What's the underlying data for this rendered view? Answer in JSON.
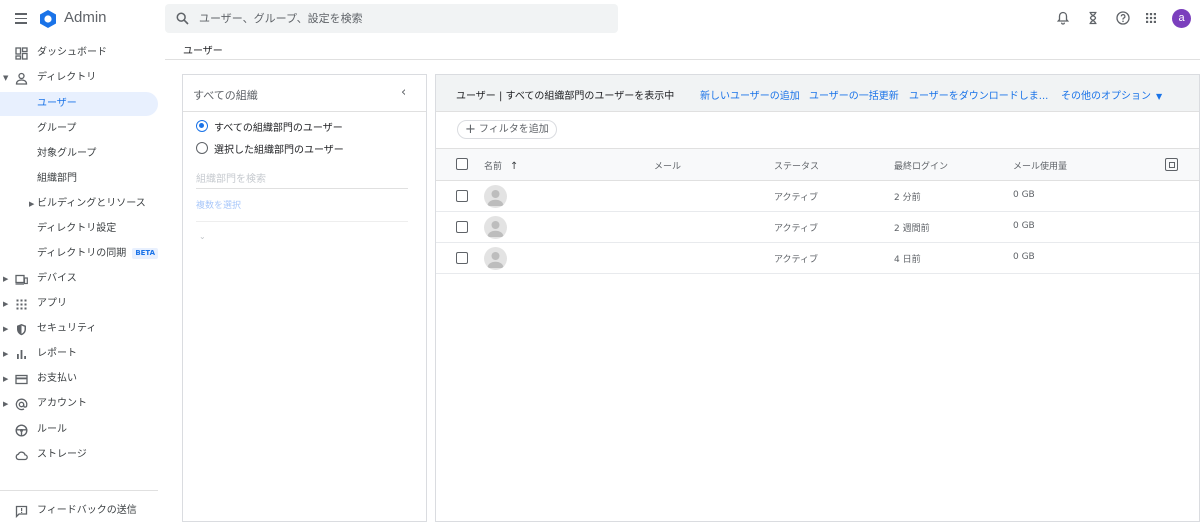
{
  "app": {
    "name": "Admin"
  },
  "search": {
    "placeholder": "ユーザー、グループ、設定を検索"
  },
  "user_avatar_letter": "a",
  "sidebar": {
    "items": [
      {
        "label": "ダッシュボード",
        "icon": "dashboard-icon"
      },
      {
        "label": "ディレクトリ",
        "icon": "person-icon",
        "expanded": true
      },
      {
        "label": "ユーザー",
        "active": true
      },
      {
        "label": "グループ"
      },
      {
        "label": "対象グループ"
      },
      {
        "label": "組織部門"
      },
      {
        "label": "ビルディングとリソース"
      },
      {
        "label": "ディレクトリ設定"
      },
      {
        "label": "ディレクトリの同期",
        "badge": "BETA"
      },
      {
        "label": "デバイス",
        "icon": "devices-icon"
      },
      {
        "label": "アプリ",
        "icon": "apps-grid-icon"
      },
      {
        "label": "セキュリティ",
        "icon": "shield-icon"
      },
      {
        "label": "レポート",
        "icon": "bar-chart-icon"
      },
      {
        "label": "お支払い",
        "icon": "credit-card-icon"
      },
      {
        "label": "アカウント",
        "icon": "at-sign-icon"
      },
      {
        "label": "ルール",
        "icon": "steering-icon"
      },
      {
        "label": "ストレージ",
        "icon": "cloud-icon"
      }
    ],
    "feedback": "フィードバックの送信"
  },
  "breadcrumb": "ユーザー",
  "org_panel": {
    "title": "すべての組織",
    "radio_all": "すべての組織部門のユーザー",
    "radio_selected": "選択した組織部門のユーザー",
    "search_placeholder": "組織部門を検索",
    "multi_select": "複数を選択"
  },
  "users_panel": {
    "title": "ユーザー | すべての組織部門のユーザーを表示中",
    "actions": {
      "add_user": "新しいユーザーの追加",
      "bulk_update": "ユーザーの一括更新",
      "download": "ユーザーをダウンロードしま...",
      "more_options": "その他のオプション"
    },
    "add_filter": "フィルタを追加",
    "columns": {
      "name": "名前",
      "email": "メール",
      "status": "ステータス",
      "last_login": "最終ログイン",
      "email_usage": "メール使用量"
    },
    "rows": [
      {
        "status": "アクティブ",
        "last_login": "2 分前",
        "email_usage": "0 GB"
      },
      {
        "status": "アクティブ",
        "last_login": "2 週間前",
        "email_usage": "0 GB"
      },
      {
        "status": "アクティブ",
        "last_login": "4 日前",
        "email_usage": "0 GB"
      }
    ]
  }
}
